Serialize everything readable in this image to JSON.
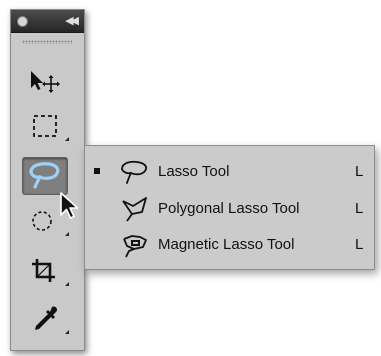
{
  "toolbox": {
    "collapse_glyph": "◀◀",
    "tools": [
      {
        "name": "move-tool",
        "icon": "move-icon"
      },
      {
        "name": "marquee-tool",
        "icon": "rectangular-marquee-icon"
      },
      {
        "name": "lasso-tool",
        "icon": "lasso-icon",
        "selected": true
      },
      {
        "name": "quick-selection-tool",
        "icon": "quick-selection-icon"
      },
      {
        "name": "crop-tool",
        "icon": "crop-icon"
      },
      {
        "name": "eyedropper-tool",
        "icon": "eyedropper-icon"
      }
    ]
  },
  "flyout": {
    "items": [
      {
        "label": "Lasso Tool",
        "shortcut": "L",
        "icon": "lasso-icon",
        "current": true
      },
      {
        "label": "Polygonal Lasso Tool",
        "shortcut": "L",
        "icon": "polygonal-lasso-icon",
        "current": false
      },
      {
        "label": "Magnetic Lasso Tool",
        "shortcut": "L",
        "icon": "magnetic-lasso-icon",
        "current": false
      }
    ]
  },
  "colors": {
    "panel_bg": "#c9c9c9",
    "titlebar": "#333333",
    "selected_tool_bg": "#7f7f7f",
    "lasso_blue": "#9fd0f5"
  }
}
